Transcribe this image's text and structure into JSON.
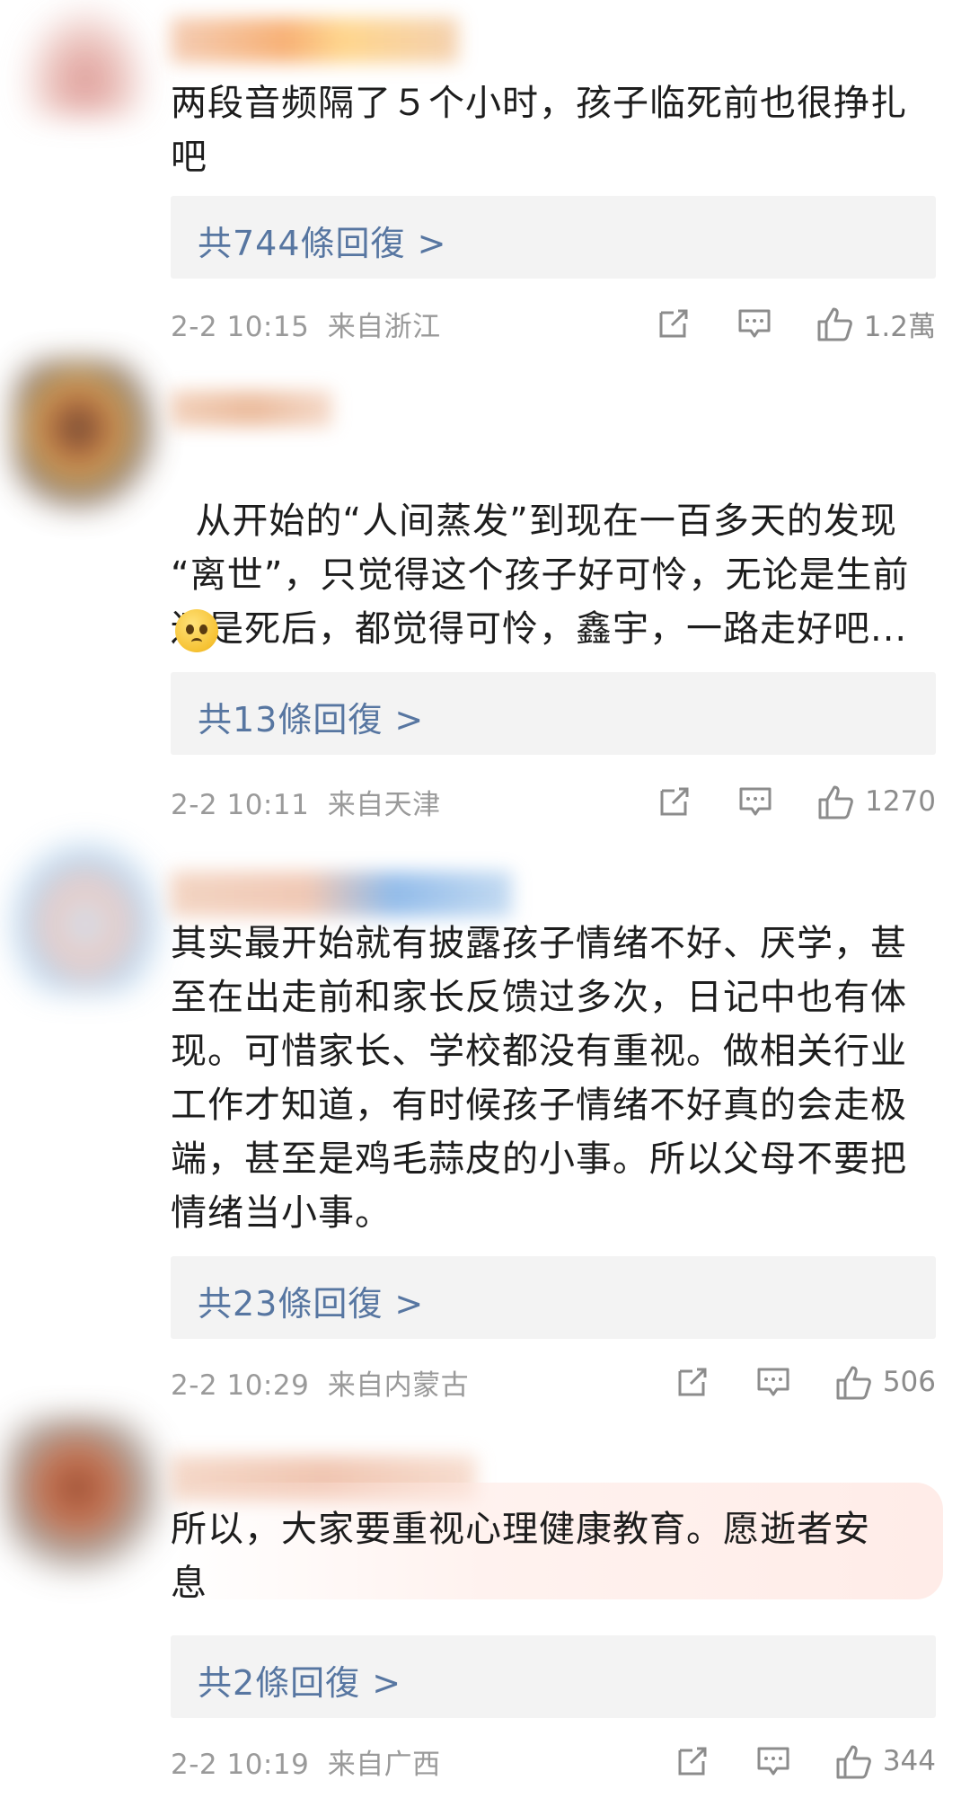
{
  "comments": [
    {
      "text": "两段音频隔了５个小时，孩子临死前也很挣扎\n吧",
      "reply_label": "共744條回復 >",
      "time": "2-2 10:15",
      "location": "来自浙江",
      "likes": "1.2萬"
    },
    {
      "text": "从开始的“人间蒸发”到现在一百多天的发现\n“离世”，只觉得这个孩子好可怜，无论是生前\n还是死后，都觉得可怜，鑫宇，一路走好吧...",
      "emoji": "sad-face",
      "reply_label": "共13條回復 >",
      "time": "2-2 10:11",
      "location": "来自天津",
      "likes": "1270"
    },
    {
      "text": "其实最开始就有披露孩子情绪不好、厌学，甚\n至在出走前和家长反馈过多次，日记中也有体\n现。可惜家长、学校都没有重视。做相关行业\n工作才知道，有时候孩子情绪不好真的会走极\n端，甚至是鸡毛蒜皮的小事。所以父母不要把\n情绪当小事。",
      "reply_label": "共23條回復 >",
      "time": "2-2 10:29",
      "location": "来自内蒙古",
      "likes": "506"
    },
    {
      "text": "所以，大家要重视心理健康教育。愿逝者安\n息",
      "reply_label": "共2條回復 >",
      "time": "2-2 10:19",
      "location": "来自广西",
      "likes": "344"
    }
  ],
  "colors": {
    "link": "#5776a1",
    "meta": "#9a9a9a",
    "reply_bg": "#f3f3f3"
  },
  "icons": {
    "share": "share-icon",
    "comment": "comment-icon",
    "like": "thumbs-up-icon"
  }
}
